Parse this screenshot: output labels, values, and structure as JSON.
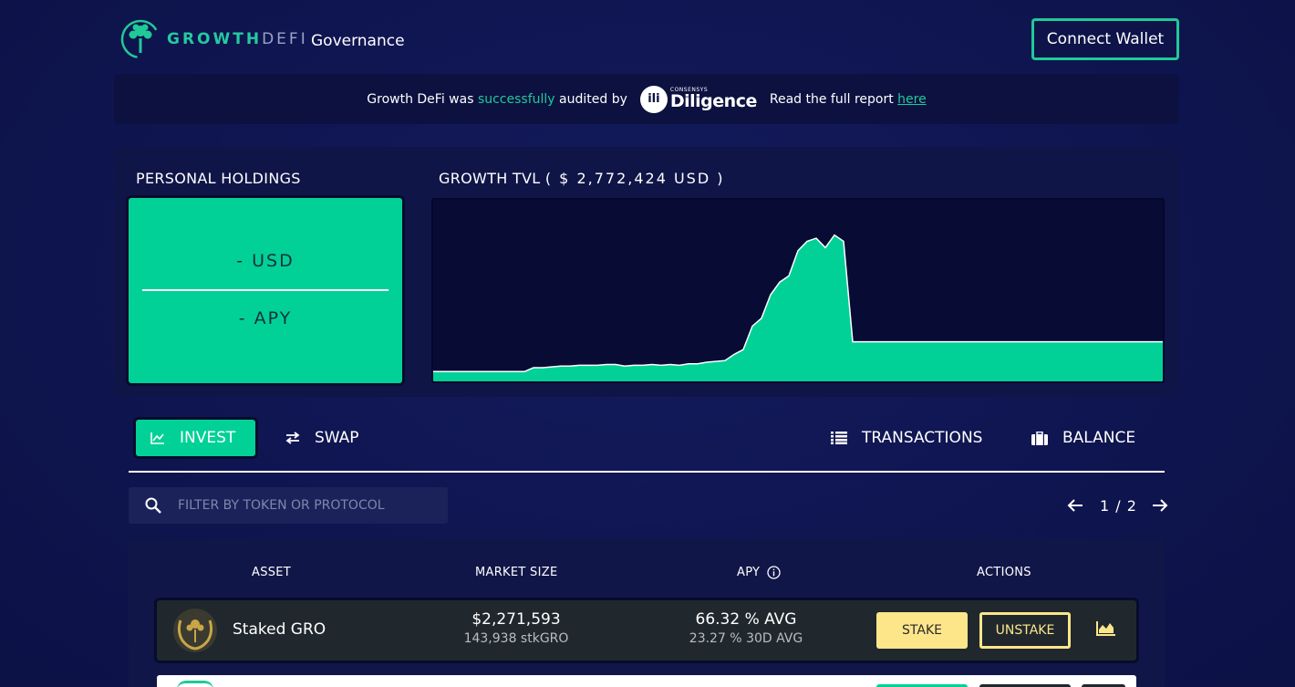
{
  "header": {
    "brand_growth": "GROWTH",
    "brand_defi": "DEFI",
    "nav_governance": "Governance",
    "connect_wallet": "Connect Wallet"
  },
  "banner": {
    "text_pre": "Growth DeFi was",
    "text_ok": "successfully",
    "text_post": "audited by",
    "auditor_small": "CONSENSYS",
    "auditor_name": "Diligence",
    "report_text": "Read the full report",
    "report_link": "here"
  },
  "holdings": {
    "title": "PERSONAL HOLDINGS",
    "usd": "- USD",
    "apy": "- APY"
  },
  "tvl": {
    "title_prefix": "GROWTH TVL",
    "value": "( $ 2,772,424 USD )"
  },
  "chart_data": {
    "type": "area",
    "title": "GROWTH TVL",
    "x": [
      0,
      1,
      2,
      3,
      4,
      5,
      6,
      7,
      8,
      9,
      10,
      11,
      12,
      13,
      14,
      15,
      16,
      17,
      18,
      19,
      20,
      21,
      22,
      23,
      24,
      25,
      26,
      27,
      28,
      29,
      30,
      31,
      32,
      33,
      34,
      35,
      36,
      37,
      38,
      39,
      40,
      41,
      42,
      43,
      44,
      45,
      46,
      47,
      48,
      49,
      50,
      51,
      52,
      53,
      54,
      55,
      56,
      57,
      58,
      59,
      60,
      61,
      62,
      63,
      64,
      65,
      66,
      67,
      68,
      69,
      70,
      71,
      72,
      73,
      74,
      75,
      76,
      77,
      78,
      79,
      80
    ],
    "values": [
      0.01,
      0.01,
      0.01,
      0.01,
      0.01,
      0.01,
      0.01,
      0.01,
      0.01,
      0.01,
      0.01,
      0.035,
      0.035,
      0.04,
      0.045,
      0.045,
      0.05,
      0.05,
      0.05,
      0.055,
      0.055,
      0.045,
      0.05,
      0.05,
      0.055,
      0.05,
      0.055,
      0.05,
      0.06,
      0.06,
      0.07,
      0.075,
      0.08,
      0.12,
      0.15,
      0.3,
      0.35,
      0.5,
      0.58,
      0.62,
      0.78,
      0.84,
      0.86,
      0.8,
      0.88,
      0.84,
      0.2,
      0.2,
      0.2,
      0.2,
      0.2,
      0.2,
      0.2,
      0.2,
      0.2,
      0.2,
      0.2,
      0.2,
      0.2,
      0.2,
      0.2,
      0.2,
      0.2,
      0.2,
      0.2,
      0.2,
      0.2,
      0.2,
      0.2,
      0.2,
      0.2,
      0.2,
      0.2,
      0.2,
      0.2,
      0.2,
      0.2,
      0.2,
      0.2,
      0.2,
      0.2
    ],
    "ylim": [
      0,
      1
    ],
    "grid": false,
    "colors": {
      "fill": "#02d197",
      "line": "#ffffff",
      "background": "#080c35"
    }
  },
  "tabs": {
    "invest": "INVEST",
    "swap": "SWAP",
    "transactions": "TRANSACTIONS",
    "balance": "BALANCE"
  },
  "search": {
    "placeholder": "FILTER BY TOKEN OR PROTOCOL"
  },
  "pager": {
    "label": "1 / 2"
  },
  "table": {
    "headers": {
      "asset": "ASSET",
      "market_size": "MARKET SIZE",
      "apy": "APY",
      "actions": "ACTIONS"
    },
    "rows": [
      {
        "asset": "Staked GRO",
        "market_size": "$2,271,593",
        "market_sub": "143,938 stkGRO",
        "apy": "66.32 % AVG",
        "apy_sub": "23.27 % 30D AVG",
        "stake": "STAKE",
        "unstake": "UNSTAKE"
      }
    ]
  },
  "colors": {
    "accent": "#02d197",
    "brand_green": "#20c997",
    "gold": "#fde68a",
    "background": "#0f1550"
  },
  "icons": [
    "growth-tree-logo-icon",
    "diligence-logo-icon",
    "invest-chart-icon",
    "swap-arrows-icon",
    "list-icon",
    "briefcase-icon",
    "search-icon",
    "arrow-left-icon",
    "arrow-right-icon",
    "info-icon",
    "laurel-gro-icon",
    "area-chart-icon"
  ]
}
